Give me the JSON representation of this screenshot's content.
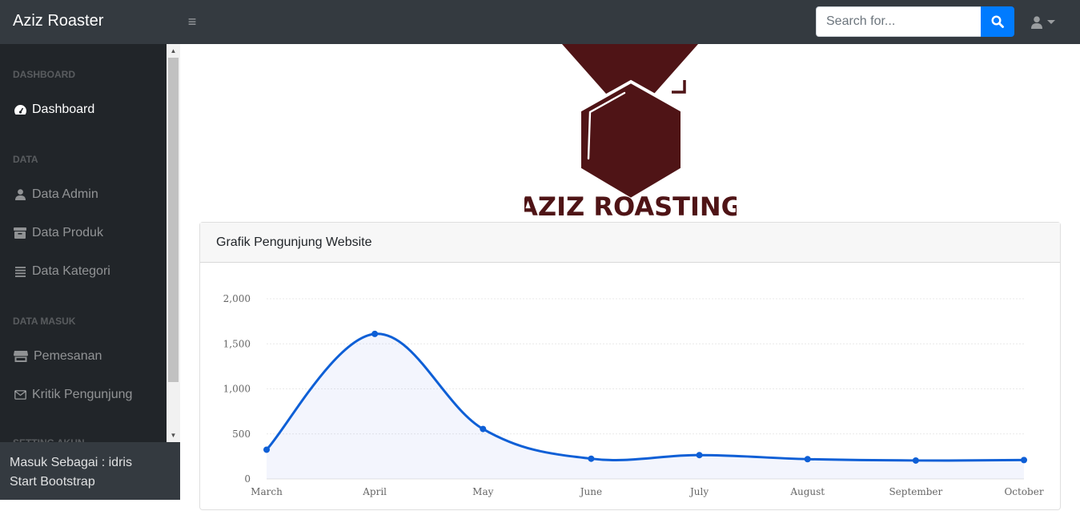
{
  "app": {
    "brand": "Aziz Roaster"
  },
  "search": {
    "placeholder": "Search for..."
  },
  "sidebar": {
    "headings": [
      "DASHBOARD",
      "DATA",
      "DATA MASUK",
      "SETTING AKUN"
    ],
    "items": [
      {
        "label": "Dashboard",
        "icon": "tachometer-icon",
        "active": true
      },
      {
        "label": "Data Admin",
        "icon": "user-icon"
      },
      {
        "label": "Data Produk",
        "icon": "box-icon"
      },
      {
        "label": "Data Kategori",
        "icon": "list-icon"
      },
      {
        "label": "Pemesanan",
        "icon": "store-icon"
      },
      {
        "label": "Kritik Pengunjung",
        "icon": "envelope-icon"
      }
    ],
    "footer": {
      "line1": "Masuk Sebagai : idris",
      "line2": "Start Bootstrap"
    }
  },
  "logo": {
    "text": "AZIZ ROASTING"
  },
  "card": {
    "title": "Grafik Pengunjung Website"
  },
  "colors": {
    "navbar": "#343a40",
    "sidebar": "#212529",
    "accent": "#007bff",
    "line": "#0e5fd6",
    "brand_logo": "#4f1416"
  },
  "chart_data": {
    "type": "area",
    "categories": [
      "March",
      "April",
      "May",
      "June",
      "July",
      "August",
      "September",
      "October"
    ],
    "values": [
      325,
      1610,
      555,
      225,
      265,
      220,
      205,
      210
    ],
    "ylim": [
      0,
      2000
    ],
    "yticks": [
      "0",
      "500",
      "1,000",
      "1,500",
      "2,000"
    ],
    "grid": true
  }
}
